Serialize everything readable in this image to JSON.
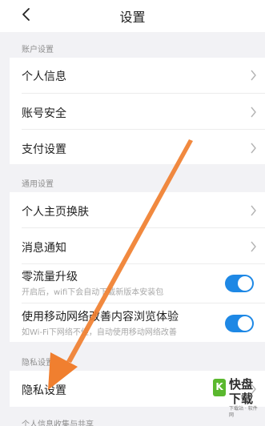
{
  "header": {
    "title": "设置"
  },
  "sections": {
    "account": {
      "title": "账户设置",
      "items": [
        {
          "label": "个人信息"
        },
        {
          "label": "账号安全"
        },
        {
          "label": "支付设置"
        }
      ]
    },
    "general": {
      "title": "通用设置",
      "items": [
        {
          "label": "个人主页换肤"
        },
        {
          "label": "消息通知"
        },
        {
          "label": "零流量升级",
          "sublabel": "开启后，wifi下会自动下载新版本安装包",
          "toggle_on": true
        },
        {
          "label": "使用移动网络改善内容浏览体验",
          "sublabel": "如Wi-Fi下网络不佳，自动使用移动网络改善",
          "toggle_on": true
        }
      ]
    },
    "privacy": {
      "title": "隐私设置",
      "items": [
        {
          "label": "隐私设置"
        }
      ]
    },
    "collection": {
      "title": "个人信息收集与共享"
    }
  },
  "watermark": {
    "badge": "K",
    "name": "快盘下载",
    "sub": "下载站 · 软件网"
  },
  "colors": {
    "toggle": "#1e88e5",
    "annotation_arrow": "#f07f2f",
    "background": "#f2f2f5"
  }
}
